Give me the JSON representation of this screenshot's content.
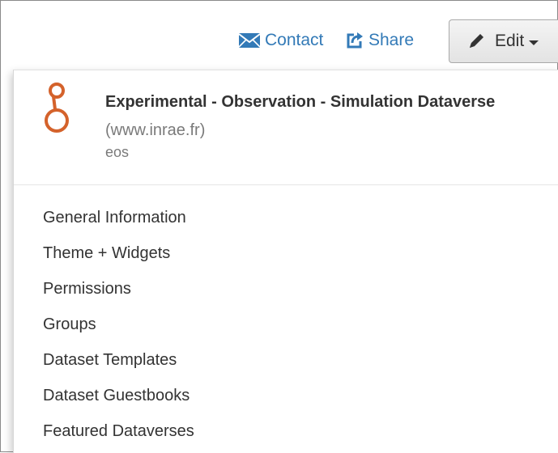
{
  "toolbar": {
    "contact_label": "Contact",
    "share_label": "Share",
    "edit_label": "Edit",
    "icons": {
      "contact": "envelope-icon",
      "share": "share-icon",
      "edit": "pencil-icon",
      "caret": "caret-down-icon"
    }
  },
  "dataverse": {
    "name": "Experimental - Observation - Simulation Dataverse",
    "affiliation": "(www.inrae.fr)",
    "alias": "eos",
    "logo_icon": "dataverse-logo-icon"
  },
  "menu": {
    "items": [
      {
        "label": "General Information"
      },
      {
        "label": "Theme + Widgets"
      },
      {
        "label": "Permissions"
      },
      {
        "label": "Groups"
      },
      {
        "label": "Dataset Templates"
      },
      {
        "label": "Dataset Guestbooks"
      },
      {
        "label": "Featured Dataverses"
      }
    ]
  },
  "colors": {
    "link": "#337ab7",
    "logo": "#d4622b",
    "text": "#333333",
    "muted": "#7a7a7a"
  }
}
